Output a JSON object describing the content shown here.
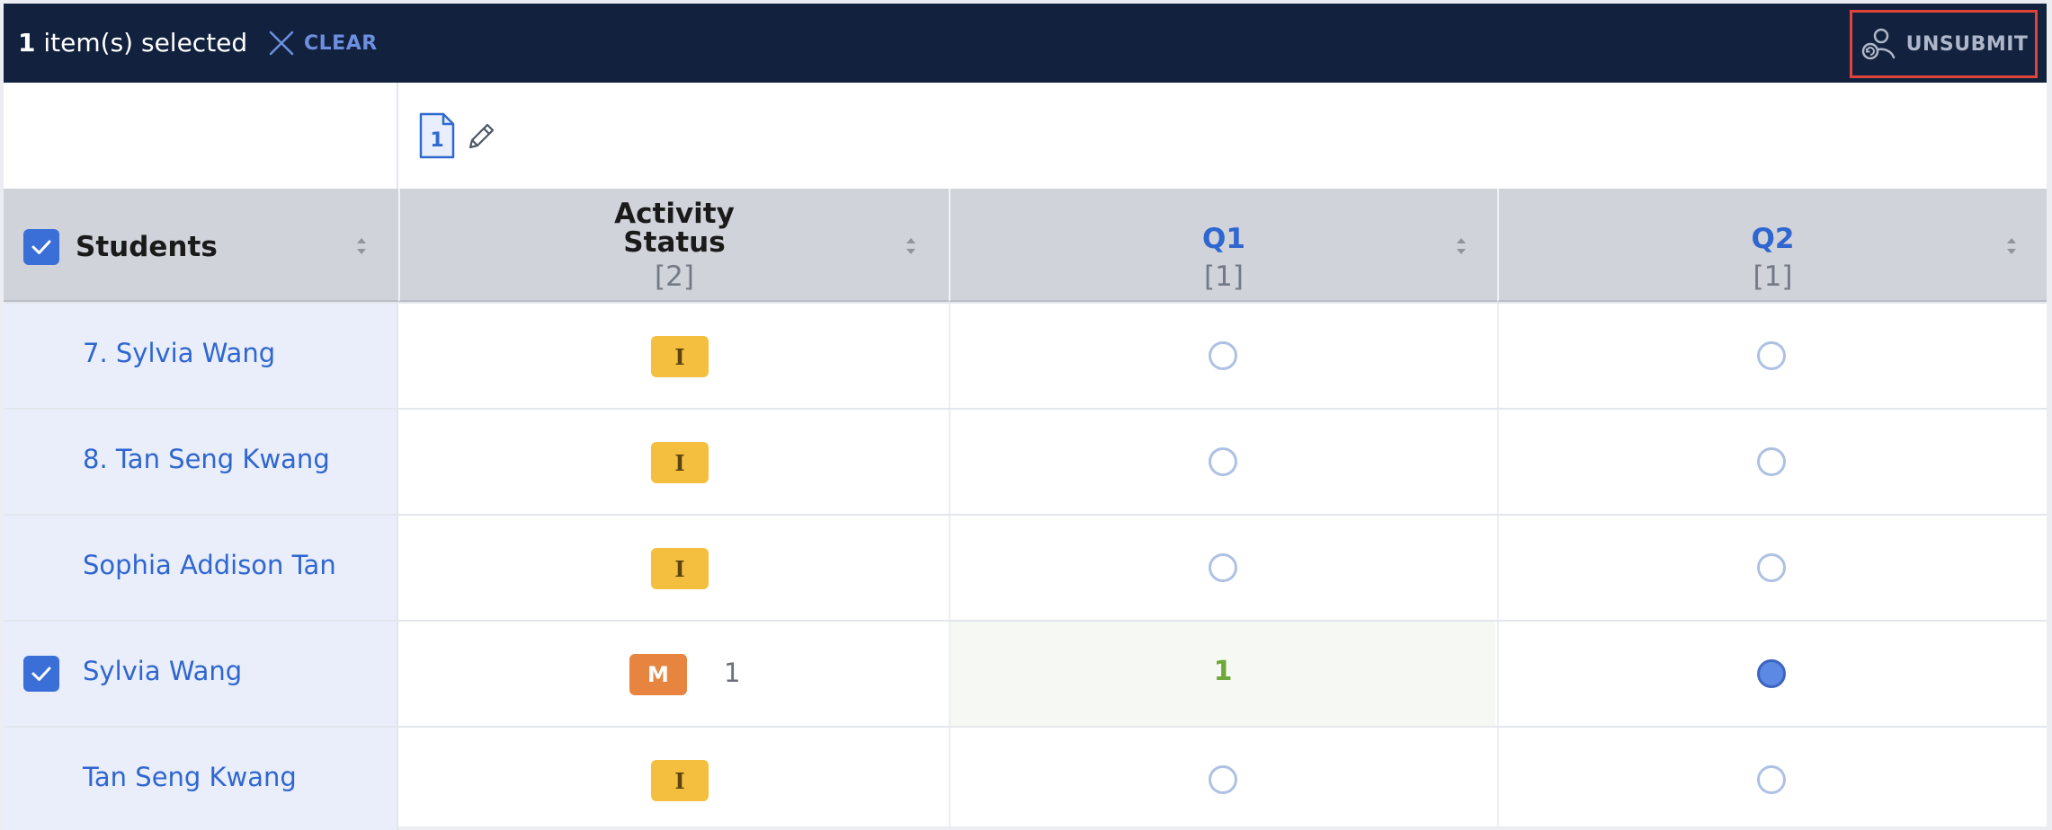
{
  "selection_bar": {
    "count": "1",
    "count_suffix": " item(s) selected",
    "clear_label": "CLEAR",
    "unsubmit_label": "UNSUBMIT"
  },
  "toolbar": {
    "doc_number": "1"
  },
  "columns": {
    "students": "Students",
    "activity_status_line1": "Activity",
    "activity_status_line2": "Status",
    "activity_status_count": "[2]",
    "q1_label": "Q1",
    "q1_count": "[1]",
    "q2_label": "Q2",
    "q2_count": "[1]"
  },
  "rows": [
    {
      "name": "7. Sylvia Wang",
      "status": "I",
      "status_count": "",
      "checked": false,
      "q1": "",
      "q2": "empty"
    },
    {
      "name": "8. Tan Seng Kwang",
      "status": "I",
      "status_count": "",
      "checked": false,
      "q1": "",
      "q2": "empty"
    },
    {
      "name": "Sophia Addison Tan",
      "status": "I",
      "status_count": "",
      "checked": false,
      "q1": "",
      "q2": "empty"
    },
    {
      "name": "Sylvia Wang",
      "status": "M",
      "status_count": "1",
      "checked": true,
      "q1": "1",
      "q2": "filled"
    },
    {
      "name": "Tan Seng Kwang",
      "status": "I",
      "status_count": "",
      "checked": false,
      "q1": "",
      "q2": "empty"
    }
  ],
  "colors": {
    "topbar": "#12223e",
    "accent_blue": "#2f66cf",
    "badge_incomplete": "#f4bf3e",
    "badge_marked": "#e7843f",
    "score_green": "#6fa83a",
    "unsubmit_outline": "#e04438"
  }
}
